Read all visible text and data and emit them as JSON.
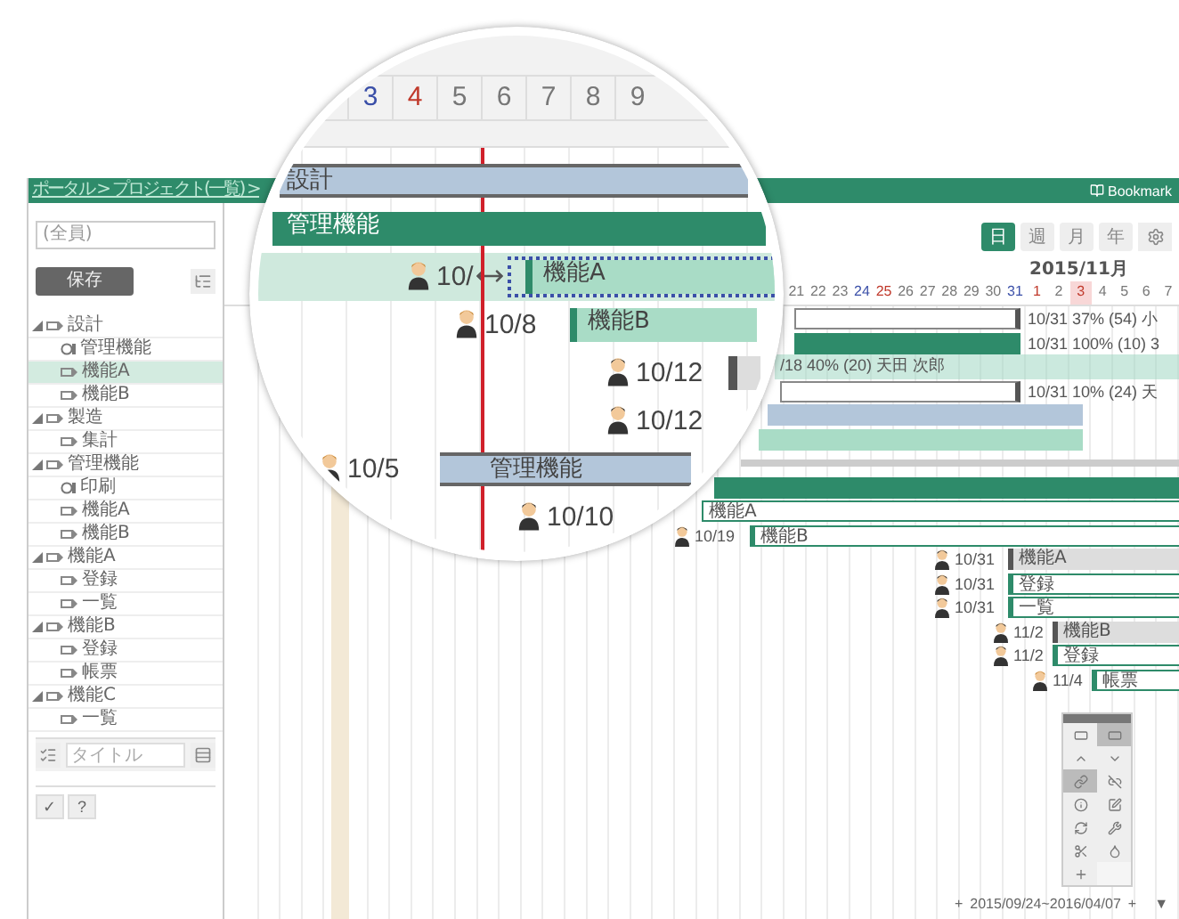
{
  "header": {
    "breadcrumb": "ポータル > プロジェクト(一覧) >",
    "bookmark": "Bookmark"
  },
  "sidebar": {
    "filter": {
      "value": "(全員)"
    },
    "save_button": "保存",
    "tree": [
      {
        "label": "設計",
        "kind": "module",
        "expanded": true,
        "selected": false,
        "children": [
          {
            "label": "管理機能",
            "kind": "group",
            "selected": false
          },
          {
            "label": "機能A",
            "kind": "module",
            "selected": true
          },
          {
            "label": "機能B",
            "kind": "module",
            "selected": false
          }
        ]
      },
      {
        "label": "製造",
        "kind": "module",
        "expanded": true,
        "selected": false,
        "children": [
          {
            "label": "集計",
            "kind": "module",
            "selected": false
          }
        ]
      },
      {
        "label": "管理機能",
        "kind": "module",
        "expanded": true,
        "selected": false,
        "children": [
          {
            "label": "印刷",
            "kind": "group",
            "selected": false
          },
          {
            "label": "機能A",
            "kind": "module",
            "selected": false
          },
          {
            "label": "機能B",
            "kind": "module",
            "selected": false
          }
        ]
      },
      {
        "label": "機能A",
        "kind": "module",
        "expanded": true,
        "selected": false,
        "children": [
          {
            "label": "登録",
            "kind": "module",
            "selected": false
          },
          {
            "label": "一覧",
            "kind": "module",
            "selected": false
          }
        ]
      },
      {
        "label": "機能B",
        "kind": "module",
        "expanded": true,
        "selected": false,
        "children": [
          {
            "label": "登録",
            "kind": "module",
            "selected": false
          },
          {
            "label": "帳票",
            "kind": "module",
            "selected": false
          }
        ]
      },
      {
        "label": "機能C",
        "kind": "module",
        "expanded": true,
        "selected": false,
        "children": [
          {
            "label": "一覧",
            "kind": "module",
            "selected": false
          }
        ]
      }
    ],
    "title_field": {
      "placeholder": "タイトル"
    },
    "footer_buttons": [
      "✓",
      "?"
    ]
  },
  "gantt": {
    "scales": [
      {
        "label": "日",
        "selected": true
      },
      {
        "label": "週",
        "selected": false
      },
      {
        "label": "月",
        "selected": false
      },
      {
        "label": "年",
        "selected": false
      }
    ],
    "month": "2015/11月",
    "days": [
      {
        "label": "21",
        "kind": "weekday"
      },
      {
        "label": "22",
        "kind": "weekday"
      },
      {
        "label": "23",
        "kind": "weekday"
      },
      {
        "label": "24",
        "kind": "saturday"
      },
      {
        "label": "25",
        "kind": "sunday"
      },
      {
        "label": "26",
        "kind": "weekday"
      },
      {
        "label": "27",
        "kind": "weekday"
      },
      {
        "label": "28",
        "kind": "weekday"
      },
      {
        "label": "29",
        "kind": "weekday"
      },
      {
        "label": "30",
        "kind": "weekday"
      },
      {
        "label": "31",
        "kind": "saturday"
      },
      {
        "label": "1",
        "kind": "sunday"
      },
      {
        "label": "2",
        "kind": "weekday"
      },
      {
        "label": "3",
        "kind": "holiday"
      },
      {
        "label": "4",
        "kind": "weekday"
      },
      {
        "label": "5",
        "kind": "weekday"
      },
      {
        "label": "6",
        "kind": "weekday"
      },
      {
        "label": "7",
        "kind": "weekday"
      }
    ],
    "rows": [
      {
        "kind": "outline",
        "selected": false,
        "note": "10/31 37% (54) 小"
      },
      {
        "kind": "filled",
        "selected": false,
        "note": "10/31 100% (10) 3"
      },
      {
        "kind": "plain",
        "selected": true,
        "note": "/18 40% (20) 天田 次郎"
      },
      {
        "kind": "outline",
        "selected": false,
        "note": "10/31 10% (24) 天"
      },
      {
        "kind": "blue",
        "selected": false
      },
      {
        "kind": "mint",
        "selected": false
      },
      {
        "kind": "thin",
        "selected": false
      },
      {
        "kind": "group",
        "selected": false
      },
      {
        "kind": "caption",
        "selected": false,
        "label": "機能A"
      },
      {
        "kind": "task",
        "selected": false,
        "date": "10/19",
        "label": "機能B"
      },
      {
        "kind": "parent",
        "selected": false,
        "date": "10/31",
        "label": "機能A"
      },
      {
        "kind": "task",
        "selected": false,
        "date": "10/31",
        "label": "登録"
      },
      {
        "kind": "task",
        "selected": false,
        "date": "10/31",
        "label": "一覧"
      },
      {
        "kind": "parent",
        "selected": false,
        "date": "11/2",
        "label": "機能B"
      },
      {
        "kind": "task",
        "selected": false,
        "date": "11/2",
        "label": "登録"
      },
      {
        "kind": "task",
        "selected": false,
        "date": "11/4",
        "label": "帳票"
      }
    ],
    "palette": [
      {
        "selected": false
      },
      {
        "selected": true
      },
      {
        "selected": false
      },
      {
        "selected": false
      },
      {
        "selected": true
      },
      {
        "selected": false
      },
      {
        "selected": false
      },
      {
        "selected": false
      },
      {
        "selected": false
      },
      {
        "selected": false
      },
      {
        "selected": false
      },
      {
        "selected": false
      },
      {
        "selected": false
      }
    ],
    "period": {
      "prev": "+",
      "range": "2015/09/24~2016/04/07",
      "next": "+",
      "menu": "▼"
    }
  },
  "magnifier": {
    "days": [
      {
        "label": "3",
        "kind": "saturday"
      },
      {
        "label": "4",
        "kind": "sunday"
      },
      {
        "label": "5",
        "kind": "weekday"
      },
      {
        "label": "6",
        "kind": "weekday"
      },
      {
        "label": "7",
        "kind": "weekday"
      },
      {
        "label": "8",
        "kind": "weekday"
      },
      {
        "label": "9",
        "kind": "weekday"
      }
    ],
    "rows": [
      {
        "kind": "blue",
        "selected": false,
        "label": "設計"
      },
      {
        "kind": "group",
        "selected": false,
        "label": "管理機能"
      },
      {
        "kind": "task",
        "selected": true,
        "date": "10/",
        "label": "機能A"
      },
      {
        "kind": "task",
        "selected": false,
        "date": "10/8",
        "label": "機能B"
      },
      {
        "kind": "parent",
        "selected": false,
        "date": "10/12"
      },
      {
        "selected": false,
        "date": "10/12"
      },
      {
        "kind": "blue",
        "selected": false,
        "date": "10/5",
        "label": "管理機能"
      },
      {
        "selected": false,
        "date": "10/10"
      }
    ]
  }
}
